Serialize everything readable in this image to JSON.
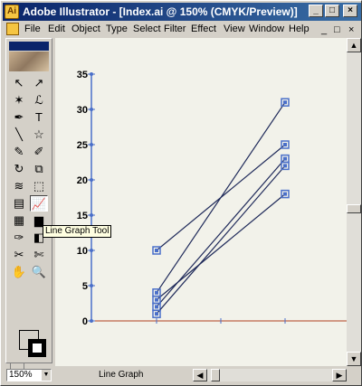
{
  "window": {
    "title": "Adobe Illustrator - [Index.ai @ 150% (CMYK/Preview)]",
    "app_icon": "illustrator-icon",
    "min_glyph": "_",
    "max_glyph": "□",
    "close_glyph": "×"
  },
  "menu": {
    "items": [
      "File",
      "Edit",
      "Object",
      "Type",
      "Select",
      "Filter",
      "Effect",
      "View",
      "Window",
      "Help"
    ],
    "doc_controls": [
      "_",
      "□",
      "×"
    ]
  },
  "toolbox": {
    "tooltip": "Line Graph Tool",
    "tools": [
      {
        "name": "selection-tool-icon",
        "glyph": "↖"
      },
      {
        "name": "direct-selection-tool-icon",
        "glyph": "↗"
      },
      {
        "name": "magic-wand-tool-icon",
        "glyph": "✶"
      },
      {
        "name": "lasso-tool-icon",
        "glyph": "ℒ"
      },
      {
        "name": "pen-tool-icon",
        "glyph": "✒"
      },
      {
        "name": "type-tool-icon",
        "glyph": "T"
      },
      {
        "name": "line-segment-tool-icon",
        "glyph": "╲"
      },
      {
        "name": "star-tool-icon",
        "glyph": "☆"
      },
      {
        "name": "paintbrush-tool-icon",
        "glyph": "✎"
      },
      {
        "name": "pencil-tool-icon",
        "glyph": "✐"
      },
      {
        "name": "rotate-tool-icon",
        "glyph": "↻"
      },
      {
        "name": "scale-tool-icon",
        "glyph": "⧉"
      },
      {
        "name": "warp-tool-icon",
        "glyph": "≋"
      },
      {
        "name": "free-transform-tool-icon",
        "glyph": "⬚"
      },
      {
        "name": "symbol-sprayer-tool-icon",
        "glyph": "▤"
      },
      {
        "name": "line-graph-tool-icon",
        "glyph": "📈"
      },
      {
        "name": "mesh-tool-icon",
        "glyph": "▦"
      },
      {
        "name": "gradient-tool-icon",
        "glyph": "▆"
      },
      {
        "name": "eyedropper-tool-icon",
        "glyph": "✑"
      },
      {
        "name": "blend-tool-icon",
        "glyph": "◧"
      },
      {
        "name": "slice-tool-icon",
        "glyph": "✂"
      },
      {
        "name": "scissors-tool-icon",
        "glyph": "✄"
      },
      {
        "name": "hand-tool-icon",
        "glyph": "✋"
      },
      {
        "name": "zoom-tool-icon",
        "glyph": "🔍"
      }
    ]
  },
  "chart_data": {
    "type": "line",
    "ylim": [
      0,
      35
    ],
    "yticks": [
      0,
      5,
      10,
      15,
      20,
      25,
      30,
      35
    ],
    "tick_labels": [
      "0",
      "5",
      "10",
      "15",
      "20",
      "25",
      "30",
      "35"
    ],
    "series": [
      {
        "values": [
          10,
          25
        ]
      },
      {
        "values": [
          4,
          31
        ]
      },
      {
        "values": [
          2,
          23
        ]
      },
      {
        "values": [
          1,
          22
        ]
      },
      {
        "values": [
          3,
          18
        ]
      }
    ],
    "colors": {
      "axis": "#4a6fc9",
      "line": "#1f2a5a",
      "baseline": "#b04020",
      "point": "#4a6fc9"
    }
  },
  "status": {
    "zoom": "150%",
    "tool_label": "Line Graph"
  }
}
